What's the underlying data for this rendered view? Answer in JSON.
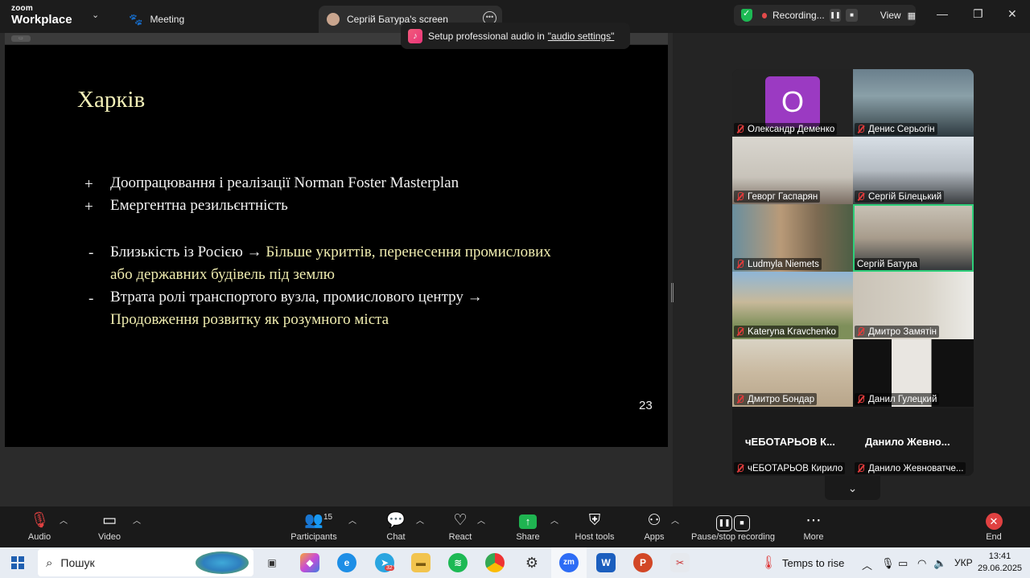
{
  "app": {
    "brand_line1": "zoom",
    "brand_line2": "Workplace",
    "tab_meeting": "Meeting",
    "tab_screen": "Сергій Батура's screen",
    "recording": "Recording...",
    "view": "View"
  },
  "notice": {
    "text": "Setup professional audio in",
    "link": "\"audio settings\""
  },
  "slide": {
    "title": "Харків",
    "plus_items": [
      "Доопрацювання і реалізації Norman Foster Masterplan",
      "Емергентна резильєнтність"
    ],
    "minus_items": [
      {
        "lead": "Близькість із Росією →",
        "highlight_a": " Більше укриттів, перенесення промислових",
        "highlight_b": "або державних будівель під землю"
      },
      {
        "lead": "Втрата ролі транспортого вузла, промислового центру →",
        "highlight_b": "Продовження розвитку як розумного міста"
      }
    ],
    "page_number": "23"
  },
  "gallery": {
    "tiles": [
      {
        "name": "Олександр Деменко",
        "avatar_letter": "O"
      },
      {
        "name": "Денис Серьогін"
      },
      {
        "name": "Геворг Гаспарян"
      },
      {
        "name": "Сергій Білецький"
      },
      {
        "name": "Ludmyla Niemets"
      },
      {
        "name": "Сергій Батура"
      },
      {
        "name": "Kateryna Kravchenko"
      },
      {
        "name": "Дмитро Замятін"
      },
      {
        "name": "Дмитро Бондар"
      },
      {
        "name": "Данил Гулецкий"
      }
    ],
    "bottom_big": [
      "чЕБОТАРЬОВ  К...",
      "Данило  Жевно..."
    ],
    "bottom_names": [
      "чЕБОТАРЬОВ Кирило",
      "Данило Жевноватче..."
    ]
  },
  "toolbar": {
    "audio": "Audio",
    "video": "Video",
    "participants": "Participants",
    "participants_count": "15",
    "chat": "Chat",
    "react": "React",
    "share": "Share",
    "host_tools": "Host tools",
    "apps": "Apps",
    "pause_stop": "Pause/stop recording",
    "more": "More",
    "end": "End"
  },
  "taskbar": {
    "search": "Пошук",
    "telegram_badge": "32",
    "weather": "Temps to rise",
    "lang": "УКР",
    "time": "13:41",
    "date": "29.06.2025"
  }
}
